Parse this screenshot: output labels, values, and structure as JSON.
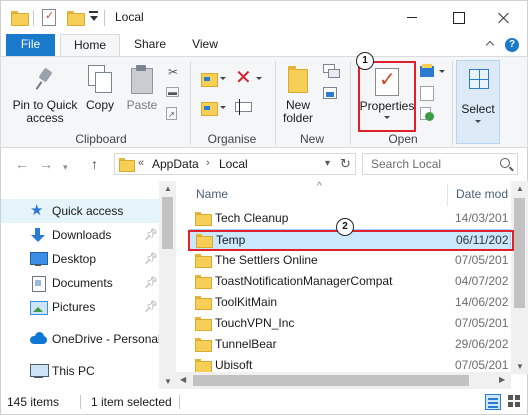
{
  "window": {
    "title": "Local"
  },
  "ribbon_tabs": {
    "file": "File",
    "home": "Home",
    "share": "Share",
    "view": "View"
  },
  "ribbon": {
    "clipboard": {
      "pin_label": "Pin to Quick access",
      "copy_label": "Copy",
      "paste_label": "Paste",
      "group_label": "Clipboard"
    },
    "organise": {
      "group_label": "Organise"
    },
    "new": {
      "new_folder_label": "New folder",
      "group_label": "New"
    },
    "open": {
      "properties_label": "Properties",
      "group_label": "Open"
    },
    "select": {
      "select_label": "Select"
    }
  },
  "annotations": {
    "badge_1": "1",
    "badge_2": "2"
  },
  "address": {
    "prefix": "«",
    "crumbs": [
      "AppData",
      "Local"
    ],
    "search_placeholder": "Search Local"
  },
  "nav": {
    "items": [
      {
        "label": "Quick access",
        "icon": "star-icon",
        "active": true
      },
      {
        "label": "Downloads",
        "icon": "download-icon",
        "pinned": true
      },
      {
        "label": "Desktop",
        "icon": "desktop-icon",
        "pinned": true
      },
      {
        "label": "Documents",
        "icon": "documents-icon",
        "pinned": true
      },
      {
        "label": "Pictures",
        "icon": "pictures-icon",
        "pinned": true
      },
      {
        "label": "OneDrive - Personal",
        "icon": "onedrive-icon"
      },
      {
        "label": "This PC",
        "icon": "this-pc-icon"
      }
    ]
  },
  "files": {
    "headers": {
      "name": "Name",
      "date": "Date mod"
    },
    "rows": [
      {
        "name": "Tech Cleanup",
        "date": "14/03/201"
      },
      {
        "name": "Temp",
        "date": "06/11/202",
        "selected": true
      },
      {
        "name": "The Settlers Online",
        "date": "07/05/201"
      },
      {
        "name": "ToastNotificationManagerCompat",
        "date": "04/07/202"
      },
      {
        "name": "ToolKitMain",
        "date": "14/06/202"
      },
      {
        "name": "TouchVPN_Inc",
        "date": "07/05/201"
      },
      {
        "name": "TunnelBear",
        "date": "29/06/202"
      },
      {
        "name": "Ubisoft",
        "date": "07/05/201"
      }
    ]
  },
  "status": {
    "item_count": "145 items",
    "selected": "1 item selected"
  },
  "colors": {
    "accent": "#1979ca",
    "highlight": "#e0202a",
    "selection": "#cce8ff"
  }
}
